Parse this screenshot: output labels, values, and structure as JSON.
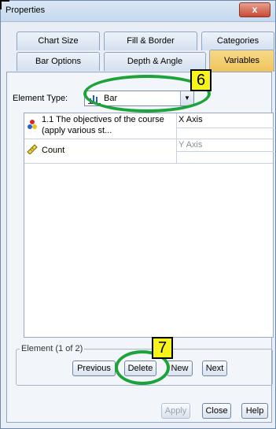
{
  "window": {
    "title": "Properties",
    "close_label": "x"
  },
  "tabs_row1": [
    "Chart Size",
    "Fill & Border",
    "Categories"
  ],
  "tabs_row2": [
    "Bar Options",
    "Depth & Angle",
    "Variables"
  ],
  "element_type": {
    "label": "Element Type:",
    "value": "Bar",
    "icon": "bar-chart-icon"
  },
  "variables": [
    {
      "name_line1": "1.1 The objectives of the course",
      "name_line2": "(apply various st...",
      "axis": "X Axis",
      "icon": "nominal-variable-icon"
    },
    {
      "name_line1": "Count",
      "name_line2": "",
      "axis": "Y Axis",
      "icon": "ruler-scale-icon"
    }
  ],
  "element_group": {
    "label": "Element (1 of 2)",
    "previous": "Previous",
    "delete": "Delete",
    "new": "New",
    "next": "Next"
  },
  "footer": {
    "apply": "Apply",
    "close": "Close",
    "help": "Help"
  },
  "annotations": {
    "marker6": "6",
    "marker7": "7",
    "highlight_color": "#1ea23a",
    "marker_color": "#f7f41c"
  }
}
